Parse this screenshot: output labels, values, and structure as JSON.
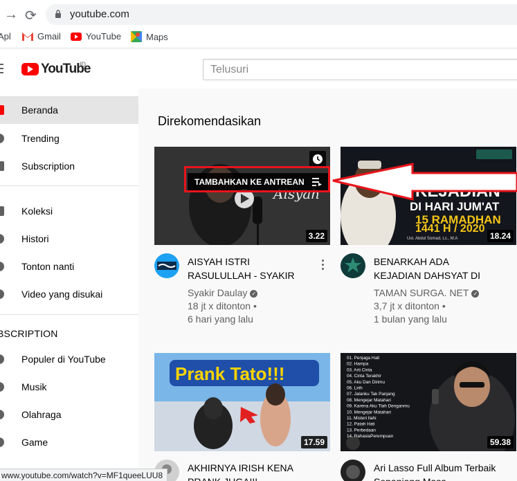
{
  "browser": {
    "url": "youtube.com",
    "bookmarks": [
      {
        "label": "Apl"
      },
      {
        "label": "Gmail"
      },
      {
        "label": "YouTube"
      },
      {
        "label": "Maps"
      }
    ],
    "status_url": "www.youtube.com/watch?v=MF1queeLUU8"
  },
  "header": {
    "logo_text": "YouTube",
    "country": "ID",
    "search_placeholder": "Telusuri"
  },
  "sidebar": {
    "items": [
      {
        "label": "Beranda",
        "icon": "home-icon"
      },
      {
        "label": "Trending",
        "icon": "trending-icon"
      },
      {
        "label": "Subscription",
        "icon": "subscriptions-icon"
      },
      {
        "label": "Koleksi",
        "icon": "library-icon"
      },
      {
        "label": "Histori",
        "icon": "history-icon"
      },
      {
        "label": "Tonton nanti",
        "icon": "watch-later-icon"
      },
      {
        "label": "Video yang disukai",
        "icon": "like-icon"
      }
    ],
    "section_heading": "BSCRIPTION",
    "subscriptions": [
      {
        "label": "Populer di YouTube"
      },
      {
        "label": "Musik"
      },
      {
        "label": "Olahraga"
      },
      {
        "label": "Game"
      }
    ]
  },
  "main": {
    "section_title": "Direkomendasikan",
    "queue_tooltip": "TAMBAHKAN KE ANTREAN",
    "videos": [
      {
        "title": "AISYAH ISTRI RASULULLAH - SYAKIR DAULAY [Official...",
        "channel": "Syakir Daulay",
        "verified": true,
        "views": "18 jt x ditonton •",
        "age": "6 hari yang lalu",
        "duration": "3.22",
        "thumb_text": "Aisyah"
      },
      {
        "title": "BENARKAH ADA KEJADIAN DAHSYAT DI HARI JUM'AT...",
        "channel": "TAMAN SURGA. NET",
        "verified": true,
        "views": "3,7 jt x ditonton •",
        "age": "1 bulan yang lalu",
        "duration": "18.24",
        "thumb_lines": [
          "KEJADIAN",
          "DI HARI JUM'AT",
          "15 RAMADHAN",
          "1441 H / 2020"
        ],
        "thumb_caption": "Ust. Abdul Somad, Lc., M.A"
      },
      {
        "title": "AKHIRNYA IRISH KENA PRANK JUGA!!!",
        "duration": "17.59",
        "thumb_text": "Prank Tato!!!"
      },
      {
        "title": "Ari Lasso Full Album Terbaik Sepanjang Masa",
        "duration": "59.38",
        "tracklist": [
          "01. Penjaga Hati",
          "02. Hampa",
          "03. Arti Cinta",
          "04. Cinta Terakhir",
          "05. Aku Dan Dirimu",
          "06. Lirih",
          "07. Jalanku Tak Panjang",
          "08. Mengejar Matahari",
          "09. Karena Aku Tlah Denganmu",
          "10. Mengejar Matahari",
          "11. Misteri Ilahi",
          "12. Patah Hati",
          "13. Perbedaan",
          "14. RahasiaPerempuan"
        ]
      }
    ]
  },
  "colors": {
    "brand_red": "#ff0000",
    "annotation_red": "#e8141b",
    "sidebar_active": "#e5e5e5",
    "main_bg": "#f9f9f9"
  }
}
